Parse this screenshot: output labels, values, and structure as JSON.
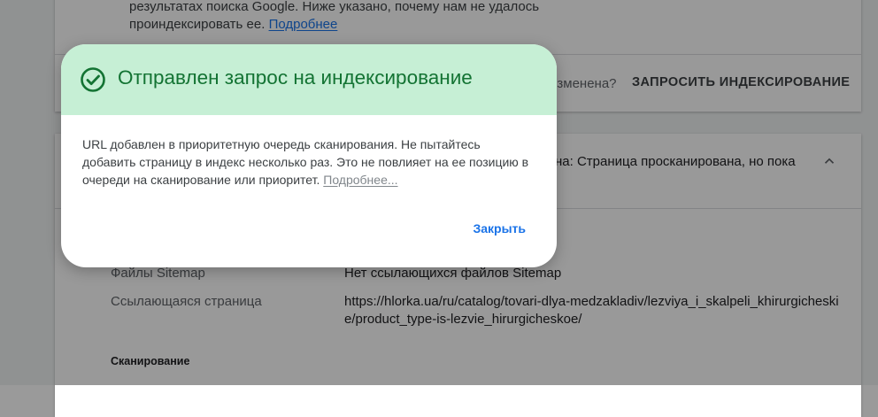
{
  "background": {
    "top_card": {
      "text": "результатах поиска Google. Ниже указано, почему нам не удалось проиндексировать ее.",
      "link": "Подробнее",
      "changed_question": "изменена?",
      "request_indexing_label": "ЗАПРОСИТЬ ИНДЕКСИРОВАНИЕ"
    },
    "status_card": {
      "status_text": "на: Страница просканирована, но пока",
      "fields": [
        {
          "label": "Файлы Sitemap",
          "value": "Нет ссылающихся файлов Sitemap"
        },
        {
          "label": "Ссылающаяся страница",
          "value": "https://hlorka.ua/ru/catalog/tovari-dlya-medzakladiv/lezviya_i_skalpeli_khirurgicheskie/product_type-is-lezvie_hirurgicheskoe/"
        }
      ],
      "section_heading": "Сканирование"
    }
  },
  "dialog": {
    "title": "Отправлен запрос на индексирование",
    "body": "URL добавлен в приоритетную очередь сканирования. Не пытайтесь добавить страницу в индекс несколько раз. Это не повлияет на ее позицию в очереди на сканирование или приоритет.",
    "link": "Подробнее...",
    "close_label": "Закрыть",
    "header_color": "#c6efd5",
    "title_color": "#137333",
    "icon": "check-circle-icon"
  }
}
